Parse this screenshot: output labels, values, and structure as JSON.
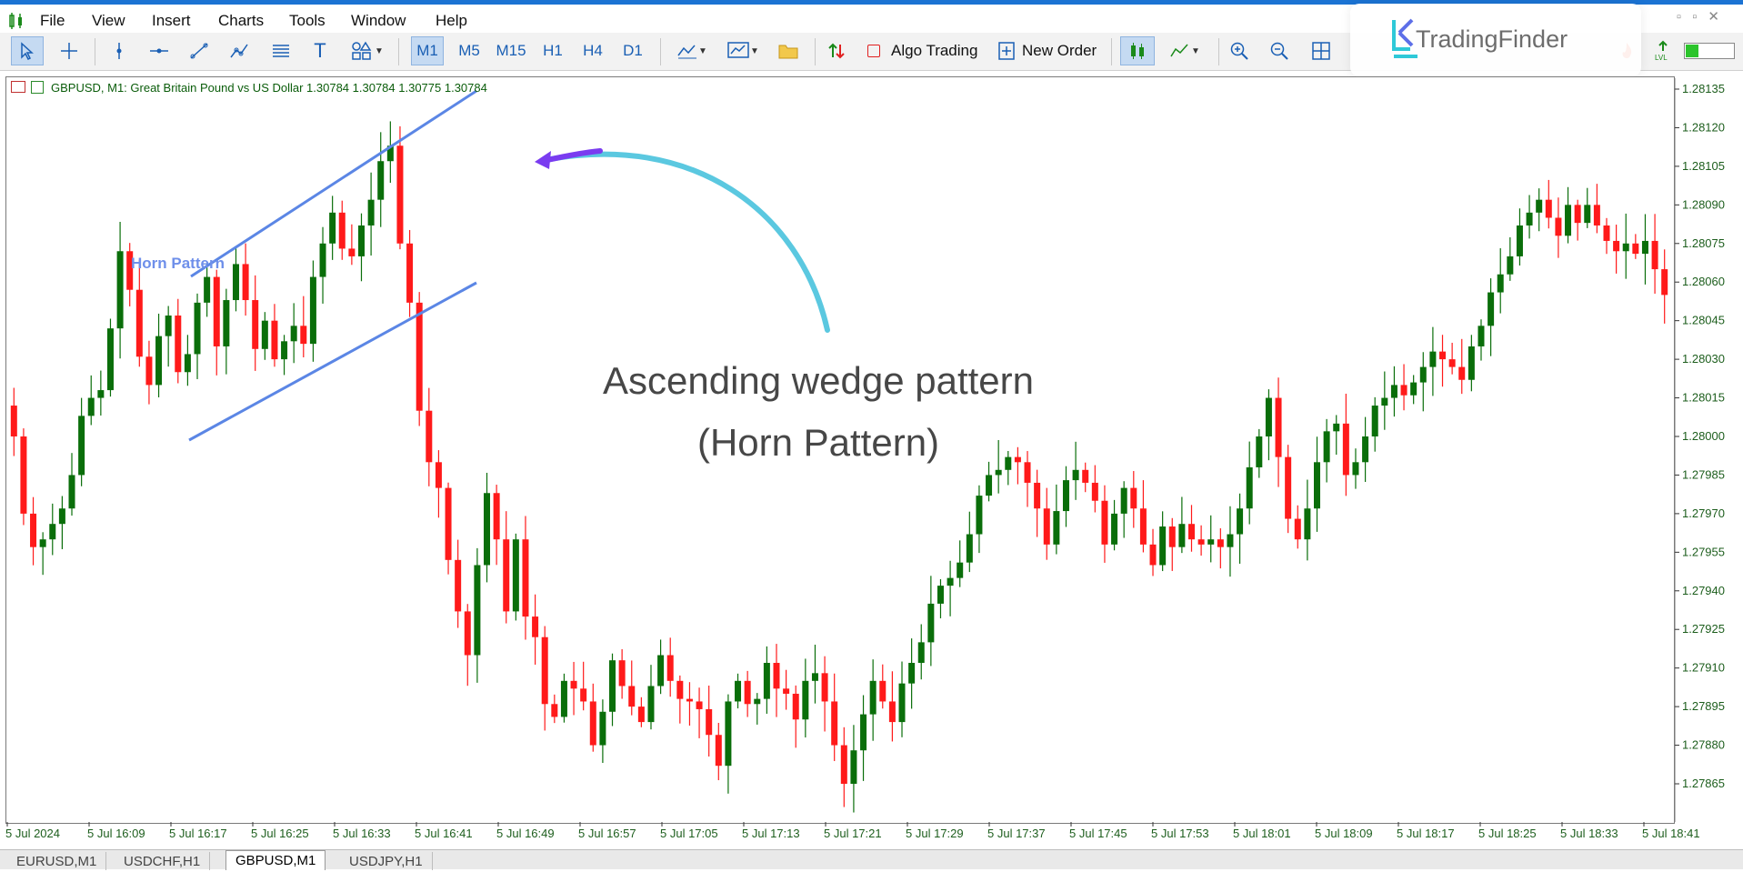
{
  "menu": {
    "items": [
      "File",
      "View",
      "Insert",
      "Charts",
      "Tools",
      "Window",
      "Help"
    ]
  },
  "watermark": {
    "brand": "TradingFinder"
  },
  "toolbar": {
    "timeframes": [
      "M1",
      "M5",
      "M15",
      "H1",
      "H4",
      "D1"
    ],
    "active_timeframe": "M1",
    "algo_trading_label": "Algo Trading",
    "new_order_label": "New Order"
  },
  "chart": {
    "header": "GBPUSD, M1:  Great Britain Pound vs US Dollar  1.30784 1.30784 1.30775 1.30784",
    "annotation_line1": "Ascending wedge pattern",
    "annotation_line2": "(Horn Pattern)",
    "horn_label": "Horn Pattern",
    "colors": {
      "bull": "#0a6e0a",
      "bear": "#ff1a1a",
      "wedge_line": "#5b86e5",
      "arrow_start": "#5bc8e0",
      "arrow_end": "#7a3cf0"
    }
  },
  "chart_data": {
    "type": "candlestick",
    "price_ticks": [
      "1.28135",
      "1.28120",
      "1.28105",
      "1.28090",
      "1.28075",
      "1.28060",
      "1.28045",
      "1.28030",
      "1.28015",
      "1.28000",
      "1.27985",
      "1.27970",
      "1.27955",
      "1.27940",
      "1.27925",
      "1.27910",
      "1.27895",
      "1.27880",
      "1.27865"
    ],
    "time_ticks": [
      "5 Jul 2024",
      "5 Jul 16:09",
      "5 Jul 16:17",
      "5 Jul 16:25",
      "5 Jul 16:33",
      "5 Jul 16:41",
      "5 Jul 16:49",
      "5 Jul 16:57",
      "5 Jul 17:05",
      "5 Jul 17:13",
      "5 Jul 17:21",
      "5 Jul 17:29",
      "5 Jul 17:37",
      "5 Jul 17:45",
      "5 Jul 17:53",
      "5 Jul 18:01",
      "5 Jul 18:09",
      "5 Jul 18:17",
      "5 Jul 18:25",
      "5 Jul 18:33",
      "5 Jul 18:41"
    ],
    "ylim": [
      1.2786,
      1.2814
    ],
    "closes": [
      1.28,
      1.2797,
      1.27957,
      1.2796,
      1.27966,
      1.27972,
      1.27985,
      1.28008,
      1.28015,
      1.28018,
      1.28042,
      1.28072,
      1.28057,
      1.28031,
      1.2802,
      1.28039,
      1.28047,
      1.28025,
      1.28032,
      1.28052,
      1.28062,
      1.28035,
      1.28053,
      1.28067,
      1.28053,
      1.28034,
      1.28045,
      1.2803,
      1.28037,
      1.28043,
      1.28036,
      1.28062,
      1.28075,
      1.28087,
      1.28073,
      1.2807,
      1.28082,
      1.28092,
      1.28107,
      1.28113,
      1.28075,
      1.28052,
      1.2801,
      1.2799,
      1.2798,
      1.27952,
      1.27932,
      1.27915,
      1.2795,
      1.27978,
      1.2796,
      1.27932,
      1.2796,
      1.2793,
      1.27922,
      1.27896,
      1.27891,
      1.27905,
      1.27902,
      1.27897,
      1.2788,
      1.27893,
      1.27913,
      1.27903,
      1.27895,
      1.27889,
      1.27903,
      1.27915,
      1.27905,
      1.27898,
      1.27897,
      1.27894,
      1.27884,
      1.27872,
      1.27897,
      1.27905,
      1.27896,
      1.27898,
      1.27912,
      1.27902,
      1.279,
      1.2789,
      1.27905,
      1.27908,
      1.27897,
      1.2788,
      1.27865,
      1.27878,
      1.27892,
      1.27905,
      1.27897,
      1.27889,
      1.27904,
      1.27912,
      1.2792,
      1.27935,
      1.27942,
      1.27945,
      1.27951,
      1.27962,
      1.27977,
      1.27985,
      1.27987,
      1.27992,
      1.2799,
      1.27982,
      1.27972,
      1.27958,
      1.27971,
      1.27983,
      1.27987,
      1.27982,
      1.27975,
      1.27958,
      1.2797,
      1.2798,
      1.27972,
      1.27958,
      1.2795,
      1.27965,
      1.27957,
      1.27966,
      1.2796,
      1.27958,
      1.2796,
      1.27957,
      1.27962,
      1.27972,
      1.27988,
      1.28,
      1.28015,
      1.27992,
      1.27968,
      1.2796,
      1.27972,
      1.2799,
      1.28002,
      1.28005,
      1.27985,
      1.2799,
      1.28,
      1.28012,
      1.28015,
      1.2802,
      1.28016,
      1.28021,
      1.28027,
      1.28033,
      1.2803,
      1.28027,
      1.28022,
      1.28035,
      1.28043,
      1.28056,
      1.28063,
      1.2807,
      1.28082,
      1.28087,
      1.28092,
      1.28085,
      1.28078,
      1.2809,
      1.28083,
      1.2809,
      1.28082,
      1.28076,
      1.28072,
      1.28075,
      1.28071,
      1.28076,
      1.28065,
      1.28055
    ]
  },
  "tabs": [
    "EURUSD,M1",
    "USDCHF,H1",
    "GBPUSD,M1",
    "USDJPY,H1"
  ],
  "active_tab": "GBPUSD,M1"
}
